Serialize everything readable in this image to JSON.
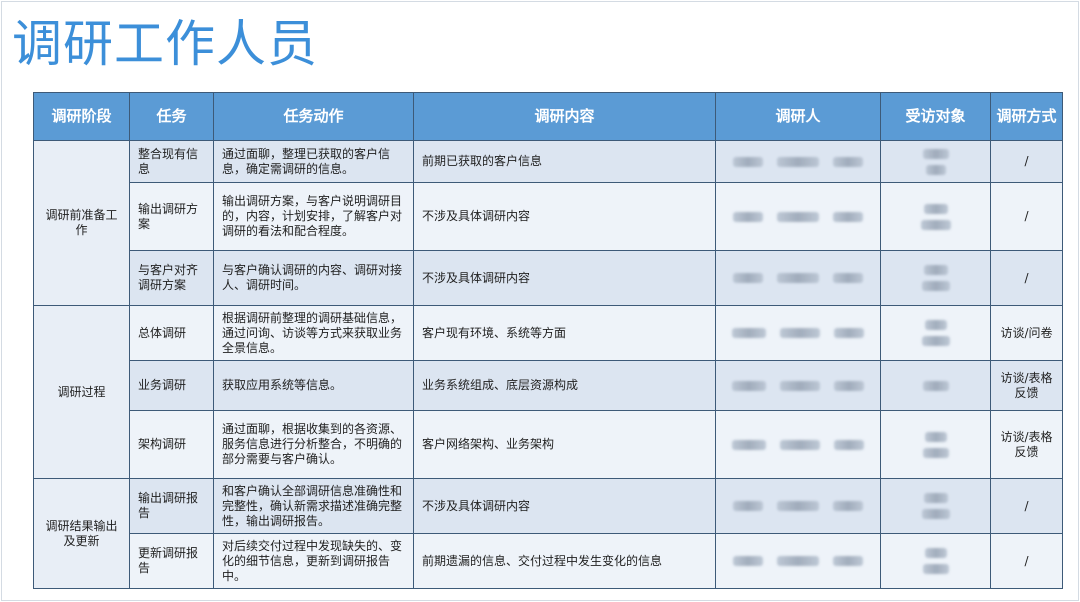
{
  "title": "调研工作人员",
  "headers": [
    "调研阶段",
    "任务",
    "任务动作",
    "调研内容",
    "调研人",
    "受访对象",
    "调研方式"
  ],
  "stages": [
    {
      "name": "调研前准备工作"
    },
    {
      "name": "调研过程"
    },
    {
      "name": "调研结果输出及更新"
    }
  ],
  "rows": [
    {
      "task": "整合现有信息",
      "action": "通过面聊，整理已获取的客户信息，确定需调研的信息。",
      "content": "前期已获取的客户信息",
      "method": "/"
    },
    {
      "task": "输出调研方案",
      "action": "输出调研方案，与客户说明调研目的，内容，计划安排，了解客户对调研的看法和配合程度。",
      "content": "不涉及具体调研内容",
      "method": "/"
    },
    {
      "task": "与客户对齐调研方案",
      "action": "与客户确认调研的内容、调研对接人、调研时间。",
      "content": "不涉及具体调研内容",
      "method": "/"
    },
    {
      "task": "总体调研",
      "action": "根据调研前整理的调研基础信息，通过问询、访谈等方式来获取业务全景信息。",
      "content": "客户现有环境、系统等方面",
      "method": "访谈/问卷"
    },
    {
      "task": "业务调研",
      "action": "获取应用系统等信息。",
      "content": "业务系统组成、底层资源构成",
      "method": "访谈/表格反馈"
    },
    {
      "task": "架构调研",
      "action": "通过面聊，根据收集到的各资源、服务信息进行分析整合，不明确的部分需要与客户确认。",
      "content": "客户网络架构、业务架构",
      "method": "访谈/表格反馈"
    },
    {
      "task": "输出调研报告",
      "action": "和客户确认全部调研信息准确性和完整性，确认新需求描述准确完整性，输出调研报告。",
      "content": "不涉及具体调研内容",
      "method": "/"
    },
    {
      "task": "更新调研报告",
      "action": "对后续交付过程中发现缺失的、变化的细节信息，更新到调研报告中。",
      "content": "前期遗漏的信息、交付过程中发生变化的信息",
      "method": "/"
    }
  ]
}
